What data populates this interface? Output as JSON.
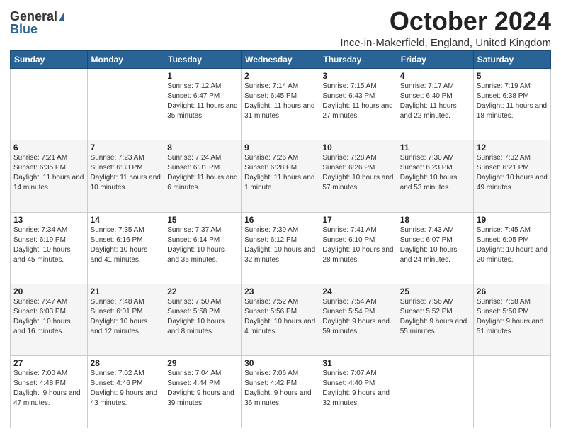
{
  "logo": {
    "general": "General",
    "blue": "Blue"
  },
  "title": "October 2024",
  "location": "Ince-in-Makerfield, England, United Kingdom",
  "days_of_week": [
    "Sunday",
    "Monday",
    "Tuesday",
    "Wednesday",
    "Thursday",
    "Friday",
    "Saturday"
  ],
  "weeks": [
    [
      {
        "day": "",
        "sunrise": "",
        "sunset": "",
        "daylight": ""
      },
      {
        "day": "",
        "sunrise": "",
        "sunset": "",
        "daylight": ""
      },
      {
        "day": "1",
        "sunrise": "Sunrise: 7:12 AM",
        "sunset": "Sunset: 6:47 PM",
        "daylight": "Daylight: 11 hours and 35 minutes."
      },
      {
        "day": "2",
        "sunrise": "Sunrise: 7:14 AM",
        "sunset": "Sunset: 6:45 PM",
        "daylight": "Daylight: 11 hours and 31 minutes."
      },
      {
        "day": "3",
        "sunrise": "Sunrise: 7:15 AM",
        "sunset": "Sunset: 6:43 PM",
        "daylight": "Daylight: 11 hours and 27 minutes."
      },
      {
        "day": "4",
        "sunrise": "Sunrise: 7:17 AM",
        "sunset": "Sunset: 6:40 PM",
        "daylight": "Daylight: 11 hours and 22 minutes."
      },
      {
        "day": "5",
        "sunrise": "Sunrise: 7:19 AM",
        "sunset": "Sunset: 6:38 PM",
        "daylight": "Daylight: 11 hours and 18 minutes."
      }
    ],
    [
      {
        "day": "6",
        "sunrise": "Sunrise: 7:21 AM",
        "sunset": "Sunset: 6:35 PM",
        "daylight": "Daylight: 11 hours and 14 minutes."
      },
      {
        "day": "7",
        "sunrise": "Sunrise: 7:23 AM",
        "sunset": "Sunset: 6:33 PM",
        "daylight": "Daylight: 11 hours and 10 minutes."
      },
      {
        "day": "8",
        "sunrise": "Sunrise: 7:24 AM",
        "sunset": "Sunset: 6:31 PM",
        "daylight": "Daylight: 11 hours and 6 minutes."
      },
      {
        "day": "9",
        "sunrise": "Sunrise: 7:26 AM",
        "sunset": "Sunset: 6:28 PM",
        "daylight": "Daylight: 11 hours and 1 minute."
      },
      {
        "day": "10",
        "sunrise": "Sunrise: 7:28 AM",
        "sunset": "Sunset: 6:26 PM",
        "daylight": "Daylight: 10 hours and 57 minutes."
      },
      {
        "day": "11",
        "sunrise": "Sunrise: 7:30 AM",
        "sunset": "Sunset: 6:23 PM",
        "daylight": "Daylight: 10 hours and 53 minutes."
      },
      {
        "day": "12",
        "sunrise": "Sunrise: 7:32 AM",
        "sunset": "Sunset: 6:21 PM",
        "daylight": "Daylight: 10 hours and 49 minutes."
      }
    ],
    [
      {
        "day": "13",
        "sunrise": "Sunrise: 7:34 AM",
        "sunset": "Sunset: 6:19 PM",
        "daylight": "Daylight: 10 hours and 45 minutes."
      },
      {
        "day": "14",
        "sunrise": "Sunrise: 7:35 AM",
        "sunset": "Sunset: 6:16 PM",
        "daylight": "Daylight: 10 hours and 41 minutes."
      },
      {
        "day": "15",
        "sunrise": "Sunrise: 7:37 AM",
        "sunset": "Sunset: 6:14 PM",
        "daylight": "Daylight: 10 hours and 36 minutes."
      },
      {
        "day": "16",
        "sunrise": "Sunrise: 7:39 AM",
        "sunset": "Sunset: 6:12 PM",
        "daylight": "Daylight: 10 hours and 32 minutes."
      },
      {
        "day": "17",
        "sunrise": "Sunrise: 7:41 AM",
        "sunset": "Sunset: 6:10 PM",
        "daylight": "Daylight: 10 hours and 28 minutes."
      },
      {
        "day": "18",
        "sunrise": "Sunrise: 7:43 AM",
        "sunset": "Sunset: 6:07 PM",
        "daylight": "Daylight: 10 hours and 24 minutes."
      },
      {
        "day": "19",
        "sunrise": "Sunrise: 7:45 AM",
        "sunset": "Sunset: 6:05 PM",
        "daylight": "Daylight: 10 hours and 20 minutes."
      }
    ],
    [
      {
        "day": "20",
        "sunrise": "Sunrise: 7:47 AM",
        "sunset": "Sunset: 6:03 PM",
        "daylight": "Daylight: 10 hours and 16 minutes."
      },
      {
        "day": "21",
        "sunrise": "Sunrise: 7:48 AM",
        "sunset": "Sunset: 6:01 PM",
        "daylight": "Daylight: 10 hours and 12 minutes."
      },
      {
        "day": "22",
        "sunrise": "Sunrise: 7:50 AM",
        "sunset": "Sunset: 5:58 PM",
        "daylight": "Daylight: 10 hours and 8 minutes."
      },
      {
        "day": "23",
        "sunrise": "Sunrise: 7:52 AM",
        "sunset": "Sunset: 5:56 PM",
        "daylight": "Daylight: 10 hours and 4 minutes."
      },
      {
        "day": "24",
        "sunrise": "Sunrise: 7:54 AM",
        "sunset": "Sunset: 5:54 PM",
        "daylight": "Daylight: 9 hours and 59 minutes."
      },
      {
        "day": "25",
        "sunrise": "Sunrise: 7:56 AM",
        "sunset": "Sunset: 5:52 PM",
        "daylight": "Daylight: 9 hours and 55 minutes."
      },
      {
        "day": "26",
        "sunrise": "Sunrise: 7:58 AM",
        "sunset": "Sunset: 5:50 PM",
        "daylight": "Daylight: 9 hours and 51 minutes."
      }
    ],
    [
      {
        "day": "27",
        "sunrise": "Sunrise: 7:00 AM",
        "sunset": "Sunset: 4:48 PM",
        "daylight": "Daylight: 9 hours and 47 minutes."
      },
      {
        "day": "28",
        "sunrise": "Sunrise: 7:02 AM",
        "sunset": "Sunset: 4:46 PM",
        "daylight": "Daylight: 9 hours and 43 minutes."
      },
      {
        "day": "29",
        "sunrise": "Sunrise: 7:04 AM",
        "sunset": "Sunset: 4:44 PM",
        "daylight": "Daylight: 9 hours and 39 minutes."
      },
      {
        "day": "30",
        "sunrise": "Sunrise: 7:06 AM",
        "sunset": "Sunset: 4:42 PM",
        "daylight": "Daylight: 9 hours and 36 minutes."
      },
      {
        "day": "31",
        "sunrise": "Sunrise: 7:07 AM",
        "sunset": "Sunset: 4:40 PM",
        "daylight": "Daylight: 9 hours and 32 minutes."
      },
      {
        "day": "",
        "sunrise": "",
        "sunset": "",
        "daylight": ""
      },
      {
        "day": "",
        "sunrise": "",
        "sunset": "",
        "daylight": ""
      }
    ]
  ]
}
